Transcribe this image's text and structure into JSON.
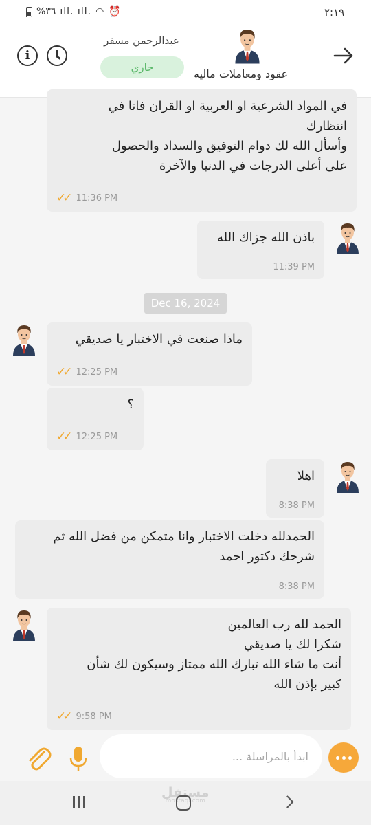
{
  "status_bar": {
    "time": "٢:١٩",
    "battery_text": "%٣٦",
    "signal_text": "ıll. ıll."
  },
  "header": {
    "teacher_name": "عبدالرحمن مسفر",
    "status": "جاري",
    "course_title": "عقود ومعاملات ماليه",
    "status_color": "#5bb86a"
  },
  "messages": [
    {
      "text": "في المواد الشرعية او العربية او القران فانا في\nانتظارك\nوأسأل الله لك دوام التوفيق والسداد والحصول\nعلى أعلى الدرجات في الدنيا والآخرة",
      "time": "11:36 PM",
      "ticks": "✓✓"
    },
    {
      "text": "باذن الله جزاك الله",
      "time": "11:39 PM"
    },
    {
      "text": "ماذا صنعت في الاختبار يا صديقي",
      "time": "12:25 PM",
      "ticks": "✓✓"
    },
    {
      "text": "؟",
      "time": "12:25 PM",
      "ticks": "✓✓"
    },
    {
      "text": "اهلا",
      "time": "8:38 PM"
    },
    {
      "text": "الحمدلله دخلت الاختبار وانا متمكن من فضل الله ثم\nشرحك دكتور احمد",
      "time": "8:38 PM"
    },
    {
      "text": "الحمد لله رب العالمين\nشكرا لك يا صديقي\nأنت ما شاء الله تبارك الله ممتاز وسيكون لك شأن\nكبير بإذن الله",
      "time": "9:58 PM",
      "ticks": "✓✓"
    }
  ],
  "date_separator": "Dec 16, 2024",
  "composer": {
    "placeholder": "ابدأ بالمراسلة ..."
  },
  "watermark": {
    "text": "مستقل",
    "subtext": "mostaql.com"
  },
  "colors": {
    "accent": "#f6a83a",
    "tick": "#f0a830",
    "status_bg": "#d9f2dd"
  },
  "icons": [
    "info-icon",
    "clock-icon",
    "back-arrow-icon",
    "paperclip-icon",
    "mic-icon",
    "more-dots-icon"
  ]
}
